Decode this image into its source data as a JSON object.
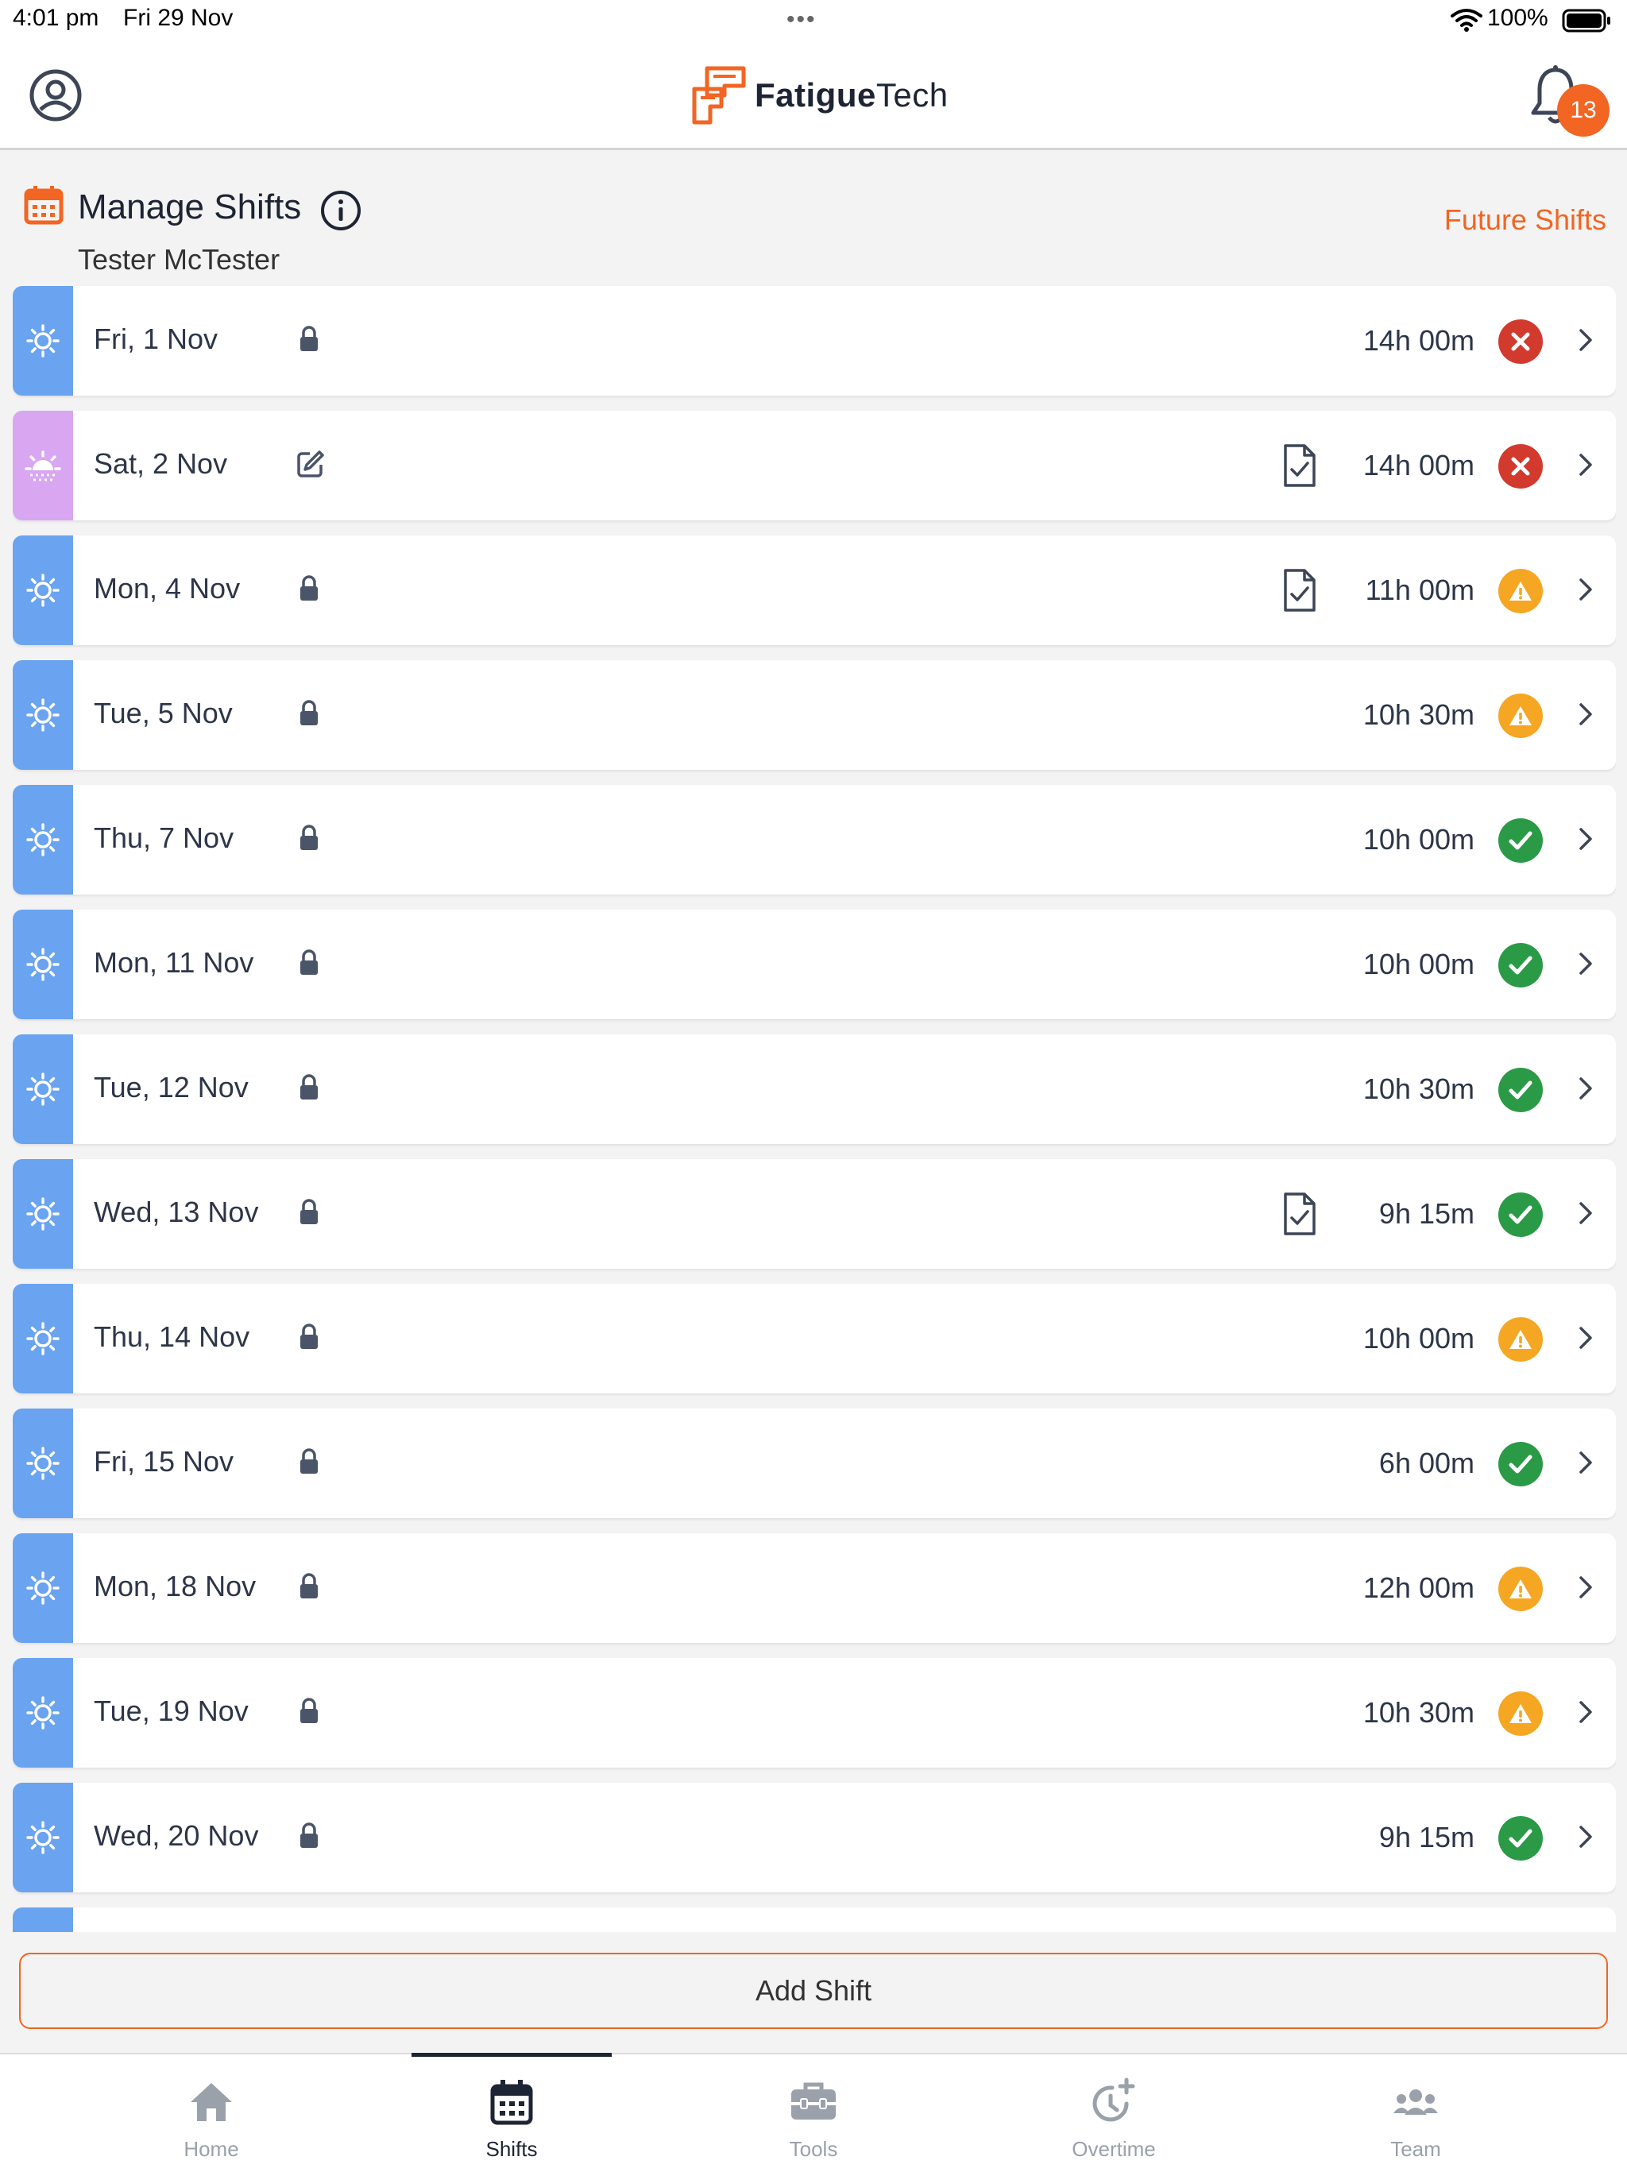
{
  "status_bar": {
    "time": "4:01 pm",
    "date": "Fri 29 Nov",
    "battery": "100%"
  },
  "header": {
    "brand_a": "Fatigue",
    "brand_b": "Tech",
    "notification_count": "13",
    "brand_color": "#f26522"
  },
  "section": {
    "title": "Manage Shifts",
    "user": "Tester McTester",
    "future_link": "Future Shifts"
  },
  "shifts": [
    {
      "date": "Fri, 1 Nov",
      "hours": "14h 00m",
      "status": "error",
      "type": "day",
      "icon": "lock",
      "doc": false
    },
    {
      "date": "Sat, 2 Nov",
      "hours": "14h 00m",
      "status": "error",
      "type": "evening",
      "icon": "edit",
      "doc": true
    },
    {
      "date": "Mon, 4 Nov",
      "hours": "11h 00m",
      "status": "warning",
      "type": "day",
      "icon": "lock",
      "doc": true
    },
    {
      "date": "Tue, 5 Nov",
      "hours": "10h 30m",
      "status": "warning",
      "type": "day",
      "icon": "lock",
      "doc": false
    },
    {
      "date": "Thu, 7 Nov",
      "hours": "10h 00m",
      "status": "ok",
      "type": "day",
      "icon": "lock",
      "doc": false
    },
    {
      "date": "Mon, 11 Nov",
      "hours": "10h 00m",
      "status": "ok",
      "type": "day",
      "icon": "lock",
      "doc": false
    },
    {
      "date": "Tue, 12 Nov",
      "hours": "10h 30m",
      "status": "ok",
      "type": "day",
      "icon": "lock",
      "doc": false
    },
    {
      "date": "Wed, 13 Nov",
      "hours": "9h 15m",
      "status": "ok",
      "type": "day",
      "icon": "lock",
      "doc": true
    },
    {
      "date": "Thu, 14 Nov",
      "hours": "10h 00m",
      "status": "warning",
      "type": "day",
      "icon": "lock",
      "doc": false
    },
    {
      "date": "Fri, 15 Nov",
      "hours": "6h 00m",
      "status": "ok",
      "type": "day",
      "icon": "lock",
      "doc": false
    },
    {
      "date": "Mon, 18 Nov",
      "hours": "12h 00m",
      "status": "warning",
      "type": "day",
      "icon": "lock",
      "doc": false
    },
    {
      "date": "Tue, 19 Nov",
      "hours": "10h 30m",
      "status": "warning",
      "type": "day",
      "icon": "lock",
      "doc": false
    },
    {
      "date": "Wed, 20 Nov",
      "hours": "9h 15m",
      "status": "ok",
      "type": "day",
      "icon": "lock",
      "doc": false
    },
    {
      "date": "",
      "hours": "",
      "status": "",
      "type": "day",
      "icon": "",
      "doc": false
    }
  ],
  "add_shift_label": "Add Shift",
  "tabs": [
    {
      "label": "Home",
      "icon": "home-icon",
      "active": false
    },
    {
      "label": "Shifts",
      "icon": "calendar-icon",
      "active": true
    },
    {
      "label": "Tools",
      "icon": "toolbox-icon",
      "active": false
    },
    {
      "label": "Overtime",
      "icon": "clock-plus-icon",
      "active": false
    },
    {
      "label": "Team",
      "icon": "team-icon",
      "active": false
    }
  ]
}
